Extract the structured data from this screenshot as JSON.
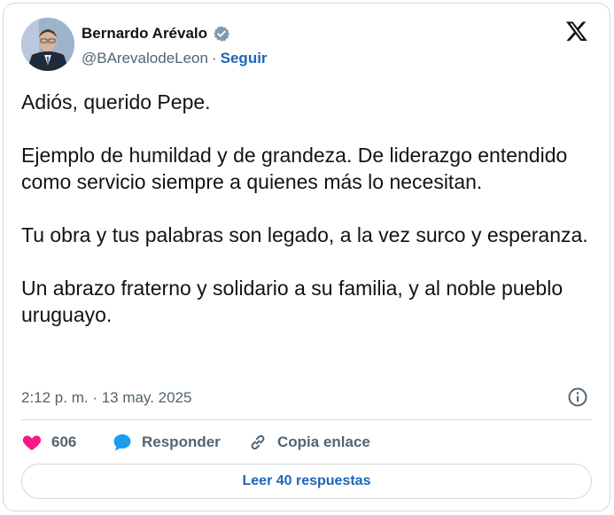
{
  "colors": {
    "accent": "#1d66b8",
    "text": "#0f1419",
    "secondary": "#536471",
    "heart": "#f91880",
    "border": "#cfd9de",
    "reply_icon": "#1d9bf0"
  },
  "author": {
    "name": "Bernardo Arévalo",
    "handle": "@BArevalodeLeon",
    "separator": "·",
    "follow_label": "Seguir",
    "verified_icon": "verified-badge-icon"
  },
  "header": {
    "logo_icon": "x-logo-icon"
  },
  "tweet": {
    "paragraphs": [
      "Adiós, querido Pepe.",
      "Ejemplo de humildad y de grandeza. De liderazgo entendido como servicio siempre a quienes más lo necesitan.",
      "Tu obra y tus palabras son legado, a la vez surco y esperanza.",
      "Un abrazo fraterno y solidario a su familia, y al noble pueblo uruguayo."
    ],
    "timestamp": "2:12 p. m. · 13 may. 2025",
    "info_icon": "info-icon"
  },
  "actions": {
    "likes_count": "606",
    "reply_label": "Responder",
    "copy_link_label": "Copia enlace"
  },
  "footer": {
    "read_replies_label": "Leer 40 respuestas"
  }
}
